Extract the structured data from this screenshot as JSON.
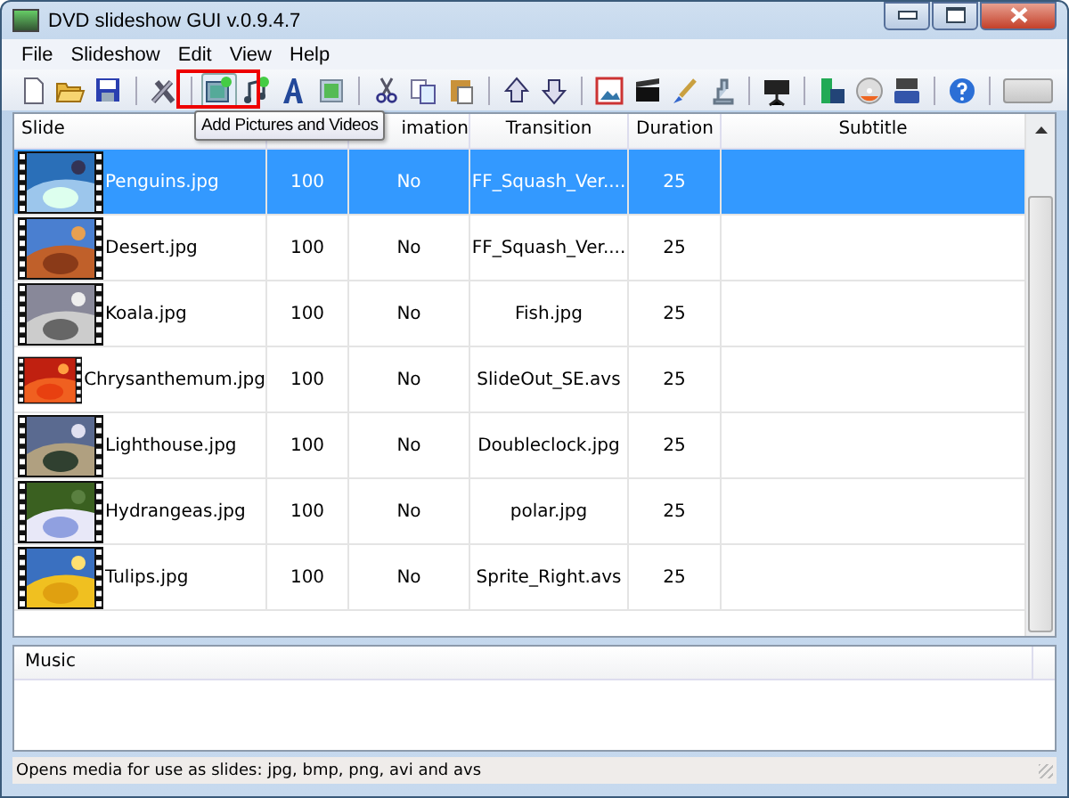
{
  "window": {
    "title": "DVD slideshow GUI v.0.9.4.7"
  },
  "menu": [
    "File",
    "Slideshow",
    "Edit",
    "View",
    "Help"
  ],
  "tooltip": "Add Pictures and Videos",
  "slides": {
    "columns": [
      {
        "label": "Slide"
      },
      {},
      {
        "label": "imation"
      },
      {
        "label": "Transition"
      },
      {
        "label": "Duration"
      },
      {
        "label": "Subtitle"
      }
    ],
    "rows": [
      {
        "name": "Penguins.jpg",
        "column_2": "100",
        "column_3": "No",
        "transition": "FF_Squash_Ver....",
        "duration": "25",
        "selected": true
      },
      {
        "name": "Desert.jpg",
        "column_2": "100",
        "column_3": "No",
        "transition": "FF_Squash_Ver....",
        "duration": "25",
        "selected": false
      },
      {
        "name": "Koala.jpg",
        "column_2": "100",
        "column_3": "No",
        "transition": "Fish.jpg",
        "duration": "25",
        "selected": false
      },
      {
        "name": "Chrysanthemum.jpg",
        "column_2": "100",
        "column_3": "No",
        "transition": "SlideOut_SE.avs",
        "duration": "25",
        "selected": false
      },
      {
        "name": "Lighthouse.jpg",
        "column_2": "100",
        "column_3": "No",
        "transition": "Doubleclock.jpg",
        "duration": "25",
        "selected": false
      },
      {
        "name": "Hydrangeas.jpg",
        "column_2": "100",
        "column_3": "No",
        "transition": "polar.jpg",
        "duration": "25",
        "selected": false
      },
      {
        "name": "Tulips.jpg",
        "column_2": "100",
        "column_3": "No",
        "transition": "Sprite_Right.avs",
        "duration": "25",
        "selected": false
      }
    ]
  },
  "music": {
    "header": "Music"
  },
  "status_bar": {
    "text": "Opens media for use as slides: jpg, bmp, png, avi and avs"
  },
  "progress": {
    "level": 0
  }
}
